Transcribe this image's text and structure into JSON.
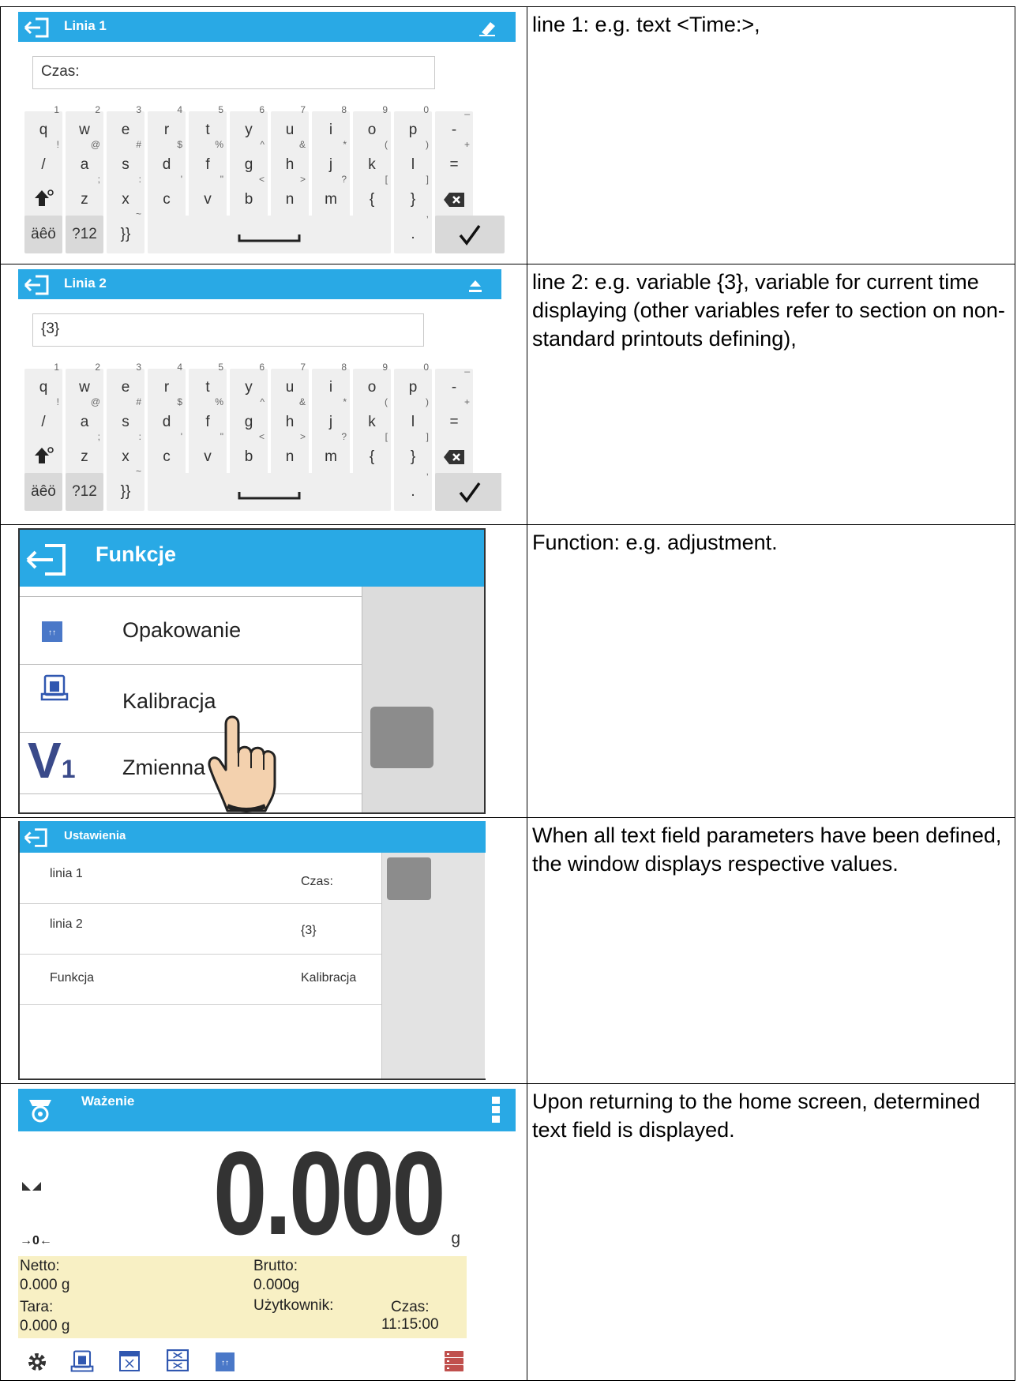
{
  "rows": [
    {
      "description": "line 1: e.g. text <Time:>,",
      "screen": {
        "title": "Linia 1",
        "input_value": "Czas:"
      }
    },
    {
      "description": "line 2: e.g. variable {3}, variable for current time displaying (other variables refer to section on non-standard printouts defining),",
      "screen": {
        "title": "Linia 2",
        "input_value": "{3}"
      }
    },
    {
      "description": "Function: e.g. adjustment.",
      "screen": {
        "title": "Funkcje",
        "items": [
          {
            "label": "Opakowanie",
            "icon": "tare-icon"
          },
          {
            "label": "Kalibracja",
            "icon": "calibration-icon"
          },
          {
            "label": "Zmienna",
            "icon": "variable-v1-icon",
            "icon_text": "V",
            "icon_sub": "1"
          }
        ]
      }
    },
    {
      "description": "When all text field parameters have been defined, the window displays respective values.",
      "screen": {
        "title": "Ustawienia",
        "rows": [
          {
            "name": "linia 1",
            "value": "Czas:"
          },
          {
            "name": "linia 2",
            "value": "{3}"
          },
          {
            "name": "Funkcja",
            "value": "Kalibracja"
          }
        ]
      }
    },
    {
      "description": "Upon returning to the home screen, determined text field is displayed.",
      "screen": {
        "title": "Ważenie",
        "reading": "0.000",
        "unit": "g",
        "zero_marker": "→0←",
        "netto_label": "Netto:",
        "netto_value": "0.000 g",
        "brutto_label": "Brutto:",
        "brutto_value": "0.000g",
        "tara_label": "Tara:",
        "tara_value": "0.000 g",
        "user_label": "Użytkownik:",
        "time_label": "Czas:",
        "time_value": "11:15:00"
      }
    }
  ],
  "keyboard": {
    "row1": [
      {
        "k": "q",
        "s": "1"
      },
      {
        "k": "w",
        "s": "2"
      },
      {
        "k": "e",
        "s": "3"
      },
      {
        "k": "r",
        "s": "4"
      },
      {
        "k": "t",
        "s": "5"
      },
      {
        "k": "y",
        "s": "6"
      },
      {
        "k": "u",
        "s": "7"
      },
      {
        "k": "i",
        "s": "8"
      },
      {
        "k": "o",
        "s": "9"
      },
      {
        "k": "p",
        "s": "0"
      },
      {
        "k": "-",
        "s": "_"
      }
    ],
    "row2": [
      {
        "k": "/",
        "s": "!"
      },
      {
        "k": "a",
        "s": "@"
      },
      {
        "k": "s",
        "s": "#"
      },
      {
        "k": "d",
        "s": "$"
      },
      {
        "k": "f",
        "s": "%"
      },
      {
        "k": "g",
        "s": "^"
      },
      {
        "k": "h",
        "s": "&"
      },
      {
        "k": "j",
        "s": "*"
      },
      {
        "k": "k",
        "s": "("
      },
      {
        "k": "l",
        "s": ")"
      },
      {
        "k": "=",
        "s": "+"
      }
    ],
    "row3": [
      {
        "k": "z",
        "s": ";"
      },
      {
        "k": "x",
        "s": ":"
      },
      {
        "k": "c",
        "s": "'"
      },
      {
        "k": "v",
        "s": "\""
      },
      {
        "k": "b",
        "s": "<"
      },
      {
        "k": "n",
        "s": ">"
      },
      {
        "k": "m",
        "s": "?"
      },
      {
        "k": "{",
        "s": "["
      },
      {
        "k": "}",
        "s": "]"
      }
    ],
    "accent_key": "äêö",
    "num_key": "?12",
    "brace_key": "}}",
    "brace_sub": "~",
    "dot_key": ".",
    "dot_sub": ","
  }
}
